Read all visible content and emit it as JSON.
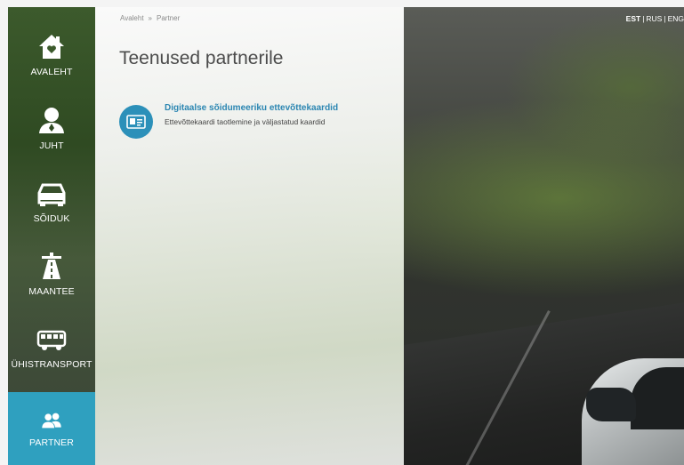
{
  "breadcrumb": {
    "home": "Avaleht",
    "separator": "»",
    "current": "Partner"
  },
  "page_title": "Teenused partnerile",
  "sidebar": {
    "items": [
      {
        "label": "AVALEHT",
        "icon": "home-icon"
      },
      {
        "label": "JUHT",
        "icon": "driver-icon"
      },
      {
        "label": "SÕIDUK",
        "icon": "car-icon"
      },
      {
        "label": "MAANTEE",
        "icon": "road-icon"
      },
      {
        "label": "ÜHISTRANSPORT",
        "icon": "bus-icon"
      },
      {
        "label": "PARTNER",
        "icon": "partner-icon",
        "active": true
      }
    ]
  },
  "services": [
    {
      "title": "Digitaalse sõidumeeriku ettevõttekaardid",
      "description": "Ettevõttekaardi taotlemine ja väljastatud kaardid",
      "icon": "id-card-icon"
    }
  ],
  "language": {
    "current": "EST",
    "options": [
      "RUS",
      "ENG"
    ],
    "separator": "|"
  },
  "colors": {
    "accent": "#2fa0bf",
    "link": "#2b86b2",
    "title": "#4b4b4b"
  }
}
